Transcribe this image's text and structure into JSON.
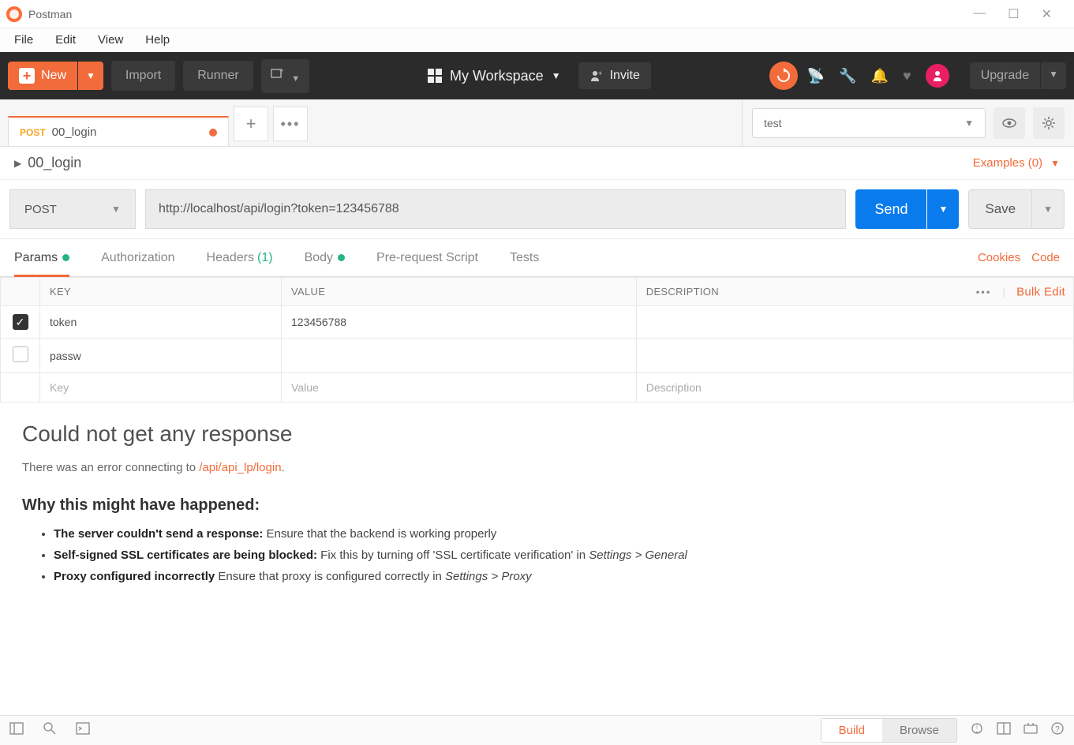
{
  "window": {
    "title": "Postman"
  },
  "menu": {
    "file": "File",
    "edit": "Edit",
    "view": "View",
    "help": "Help"
  },
  "toolbar": {
    "new": "New",
    "import": "Import",
    "runner": "Runner",
    "workspace": "My Workspace",
    "invite": "Invite",
    "upgrade": "Upgrade"
  },
  "tab": {
    "method": "POST",
    "title": "00_login"
  },
  "env": {
    "selected": "test"
  },
  "request": {
    "name": "00_login",
    "examples": "Examples (0)",
    "method": "POST",
    "url": "http://localhost/api/login?token=123456788",
    "send": "Send",
    "save": "Save"
  },
  "reqTabs": {
    "params": "Params",
    "auth": "Authorization",
    "headers": "Headers",
    "headers_count": "(1)",
    "body": "Body",
    "prereq": "Pre-request Script",
    "tests": "Tests",
    "cookies": "Cookies",
    "code": "Code"
  },
  "paramsTable": {
    "headers": {
      "key": "KEY",
      "value": "VALUE",
      "desc": "DESCRIPTION",
      "bulk": "Bulk Edit"
    },
    "rows": [
      {
        "checked": true,
        "key": "token",
        "value": "123456788",
        "desc": ""
      },
      {
        "checked": false,
        "key": "passw",
        "value": "",
        "desc": ""
      }
    ],
    "placeholders": {
      "key": "Key",
      "value": "Value",
      "desc": "Description"
    }
  },
  "response": {
    "title": "Could not get any response",
    "intro_prefix": "There was an error connecting to ",
    "intro_link": "/api/api_lp/login",
    "intro_suffix": ".",
    "why_heading": "Why this might have happened:",
    "reasons": [
      {
        "b": "The server couldn't send a response:",
        "rest": " Ensure that the backend is working properly"
      },
      {
        "b": "Self-signed SSL certificates are being blocked:",
        "rest": " Fix this by turning off 'SSL certificate verification' in ",
        "i": "Settings > General"
      },
      {
        "b": "Proxy configured incorrectly",
        "rest": " Ensure that proxy is configured correctly in ",
        "i": "Settings > Proxy"
      }
    ]
  },
  "statusBar": {
    "build": "Build",
    "browse": "Browse"
  }
}
